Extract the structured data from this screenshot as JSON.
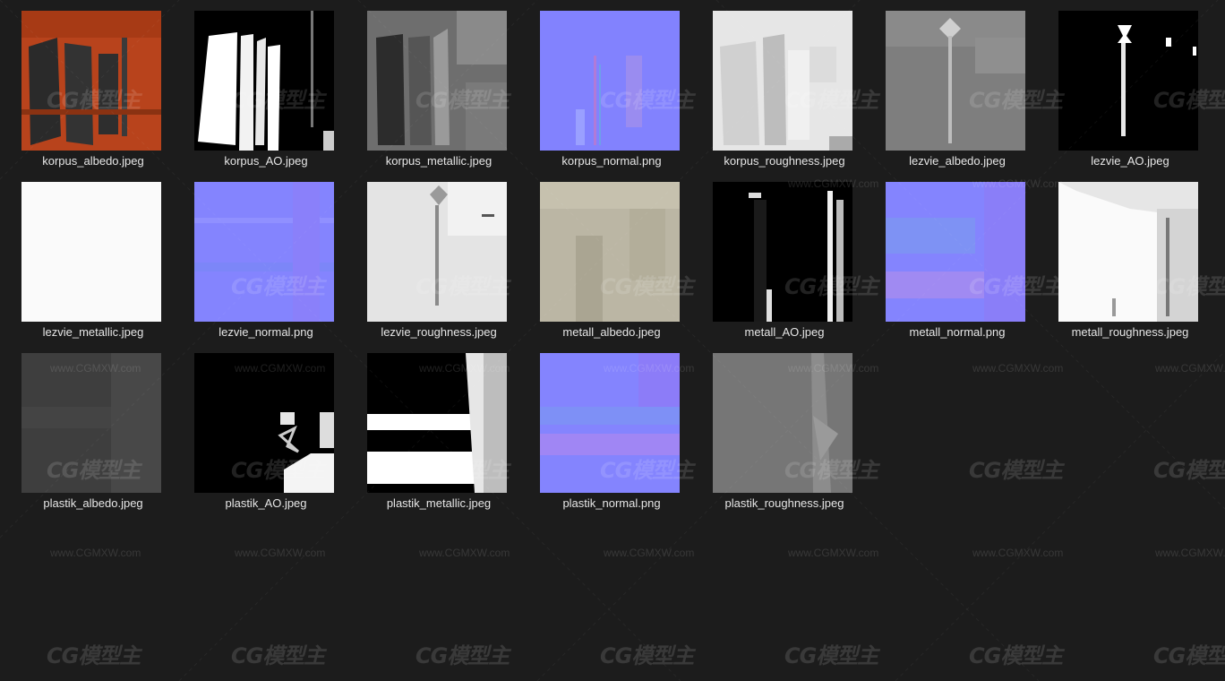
{
  "files": [
    {
      "name": "korpus_albedo.jpeg",
      "kind": "albedo-orange"
    },
    {
      "name": "korpus_AO.jpeg",
      "kind": "ao-shapes"
    },
    {
      "name": "korpus_metallic.jpeg",
      "kind": "metallic-gray"
    },
    {
      "name": "korpus_normal.png",
      "kind": "normal"
    },
    {
      "name": "korpus_roughness.jpeg",
      "kind": "roughness-light"
    },
    {
      "name": "lezvie_albedo.jpeg",
      "kind": "blade-gray"
    },
    {
      "name": "lezvie_AO.jpeg",
      "kind": "blade-ao"
    },
    {
      "name": "lezvie_metallic.jpeg",
      "kind": "white"
    },
    {
      "name": "lezvie_normal.png",
      "kind": "normal-flat"
    },
    {
      "name": "lezvie_roughness.jpeg",
      "kind": "blade-rough"
    },
    {
      "name": "metall_albedo.jpeg",
      "kind": "beige"
    },
    {
      "name": "metall_AO.jpeg",
      "kind": "dark-ao"
    },
    {
      "name": "metall_normal.png",
      "kind": "normal-stripes"
    },
    {
      "name": "metall_roughness.jpeg",
      "kind": "white-rough"
    },
    {
      "name": "plastik_albedo.jpeg",
      "kind": "dark-gray"
    },
    {
      "name": "plastik_AO.jpeg",
      "kind": "black-ao"
    },
    {
      "name": "plastik_metallic.jpeg",
      "kind": "bw-metallic"
    },
    {
      "name": "plastik_normal.png",
      "kind": "normal-bands"
    },
    {
      "name": "plastik_roughness.jpeg",
      "kind": "mid-gray"
    }
  ],
  "watermark": {
    "logo": "CG模型主",
    "url": "www.CGMXW.com"
  },
  "colors": {
    "background": "#1c1c1c",
    "label": "#e6e6e6",
    "normal_map": "#8080ff"
  }
}
